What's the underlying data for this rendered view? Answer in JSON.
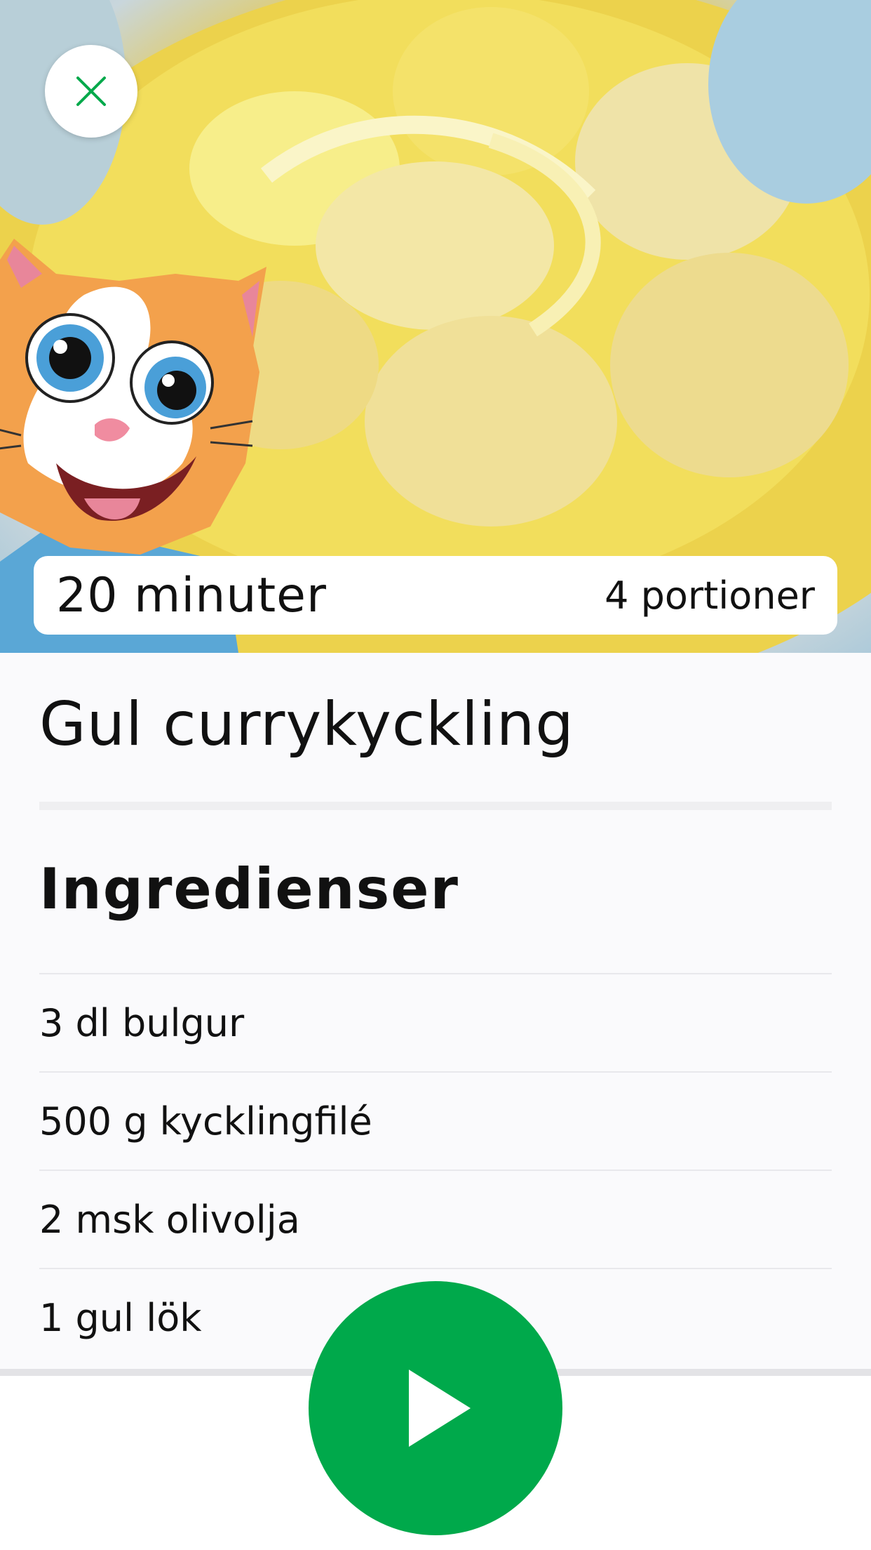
{
  "hero": {
    "time": "20 minuter",
    "portions": "4 portioner"
  },
  "recipe": {
    "title": "Gul currykyckling"
  },
  "ingredients_section": {
    "title": "Ingredienser",
    "items": [
      "3 dl bulgur",
      "500 g kycklingfilé",
      "2 msk olivolja",
      "1  gul lök"
    ]
  },
  "colors": {
    "accent": "#00a94b",
    "background": "#fafafc"
  },
  "icons": {
    "close": "close-icon",
    "play": "play-icon"
  }
}
